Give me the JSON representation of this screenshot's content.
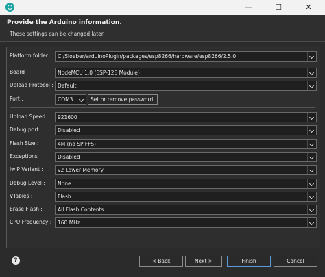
{
  "window": {
    "title_icon": "eclipse-app-icon",
    "minimize": "—",
    "maximize": "☐",
    "close": "✕"
  },
  "header": {
    "title": "Provide the Arduino information.",
    "subtitle": "These settings can be changed later."
  },
  "fields": {
    "platform_folder": {
      "label": "Platform folder :",
      "value": "C:/Sloeber/arduinoPlugin/packages/esp8266/hardware/esp8266/2.5.0"
    },
    "board": {
      "label": "Board :",
      "value": "NodeMCU 1.0 (ESP-12E Module)"
    },
    "upload_protocol": {
      "label": "Upload Protocol :",
      "value": "Default"
    },
    "port": {
      "label": "Port :",
      "value": "COM3",
      "password_button": "Set or remove password."
    },
    "upload_speed": {
      "label": "Upload Speed :",
      "value": "921600"
    },
    "debug_port": {
      "label": "Debug port :",
      "value": "Disabled"
    },
    "flash_size": {
      "label": "Flash Size :",
      "value": "4M (no SPIFFS)"
    },
    "exceptions": {
      "label": "Exceptions :",
      "value": "Disabled"
    },
    "lwip_variant": {
      "label": "lwIP Variant :",
      "value": "v2 Lower Memory"
    },
    "debug_level": {
      "label": "Debug Level :",
      "value": "None"
    },
    "vtables": {
      "label": "VTables :",
      "value": "Flash"
    },
    "erase_flash": {
      "label": "Erase Flash :",
      "value": "All Flash Contents"
    },
    "cpu_frequency": {
      "label": "CPU Frequency :",
      "value": "160 MHz"
    }
  },
  "footer": {
    "help_icon": "?",
    "back": "< Back",
    "next": "Next >",
    "finish": "Finish",
    "cancel": "Cancel"
  }
}
